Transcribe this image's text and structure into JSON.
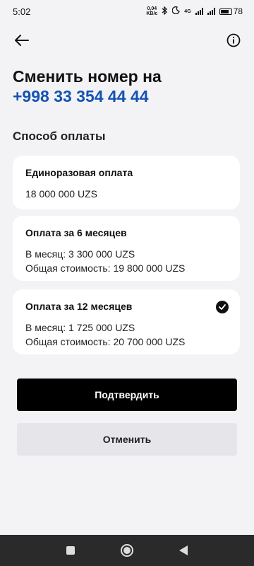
{
  "status_bar": {
    "time": "5:02",
    "net_speed_value": "0,04",
    "net_speed_unit": "KB/c",
    "network_type": "4G",
    "battery_percent": "78",
    "battery_level": 0.78
  },
  "header": {
    "back_icon": "arrow-left-icon",
    "info_icon": "info-circle-icon"
  },
  "title": {
    "line1": "Сменить номер на",
    "phone": "+998 33 354 44 44"
  },
  "section_label": "Способ оплаты",
  "payment_options": [
    {
      "title": "Единоразовая оплата",
      "lines": [
        "18 000 000 UZS"
      ],
      "selected": false
    },
    {
      "title": "Оплата за 6 месяцев",
      "lines": [
        "В месяц: 3 300 000 UZS",
        "Общая стоимость: 19 800 000 UZS"
      ],
      "selected": false
    },
    {
      "title": "Оплата за 12 месяцев",
      "lines": [
        "В месяц: 1 725 000 UZS",
        "Общая стоимость: 20 700 000 UZS"
      ],
      "selected": true
    }
  ],
  "buttons": {
    "confirm": "Подтвердить",
    "cancel": "Отменить"
  },
  "nav_bar": {
    "recents_icon": "square-icon",
    "home_icon": "circle-home-icon",
    "back_icon": "triangle-back-icon"
  },
  "colors": {
    "accent": "#1552b5",
    "background": "#f3f3f5",
    "card": "#ffffff",
    "confirm_bg": "#000000",
    "cancel_bg": "#e6e6ea"
  }
}
